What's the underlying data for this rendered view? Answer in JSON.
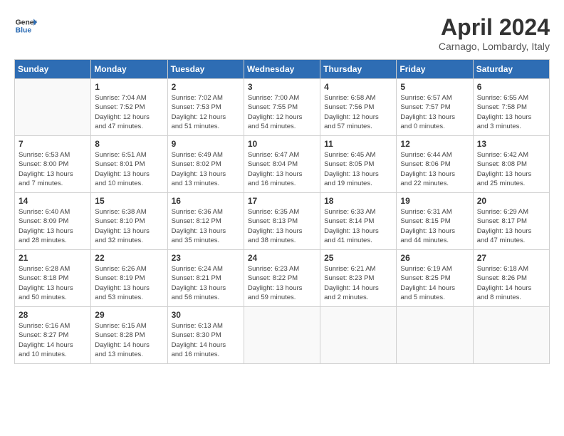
{
  "header": {
    "logo_line1": "General",
    "logo_line2": "Blue",
    "month_year": "April 2024",
    "location": "Carnago, Lombardy, Italy"
  },
  "days_of_week": [
    "Sunday",
    "Monday",
    "Tuesday",
    "Wednesday",
    "Thursday",
    "Friday",
    "Saturday"
  ],
  "weeks": [
    [
      {
        "day": "",
        "info": ""
      },
      {
        "day": "1",
        "info": "Sunrise: 7:04 AM\nSunset: 7:52 PM\nDaylight: 12 hours\nand 47 minutes."
      },
      {
        "day": "2",
        "info": "Sunrise: 7:02 AM\nSunset: 7:53 PM\nDaylight: 12 hours\nand 51 minutes."
      },
      {
        "day": "3",
        "info": "Sunrise: 7:00 AM\nSunset: 7:55 PM\nDaylight: 12 hours\nand 54 minutes."
      },
      {
        "day": "4",
        "info": "Sunrise: 6:58 AM\nSunset: 7:56 PM\nDaylight: 12 hours\nand 57 minutes."
      },
      {
        "day": "5",
        "info": "Sunrise: 6:57 AM\nSunset: 7:57 PM\nDaylight: 13 hours\nand 0 minutes."
      },
      {
        "day": "6",
        "info": "Sunrise: 6:55 AM\nSunset: 7:58 PM\nDaylight: 13 hours\nand 3 minutes."
      }
    ],
    [
      {
        "day": "7",
        "info": "Sunrise: 6:53 AM\nSunset: 8:00 PM\nDaylight: 13 hours\nand 7 minutes."
      },
      {
        "day": "8",
        "info": "Sunrise: 6:51 AM\nSunset: 8:01 PM\nDaylight: 13 hours\nand 10 minutes."
      },
      {
        "day": "9",
        "info": "Sunrise: 6:49 AM\nSunset: 8:02 PM\nDaylight: 13 hours\nand 13 minutes."
      },
      {
        "day": "10",
        "info": "Sunrise: 6:47 AM\nSunset: 8:04 PM\nDaylight: 13 hours\nand 16 minutes."
      },
      {
        "day": "11",
        "info": "Sunrise: 6:45 AM\nSunset: 8:05 PM\nDaylight: 13 hours\nand 19 minutes."
      },
      {
        "day": "12",
        "info": "Sunrise: 6:44 AM\nSunset: 8:06 PM\nDaylight: 13 hours\nand 22 minutes."
      },
      {
        "day": "13",
        "info": "Sunrise: 6:42 AM\nSunset: 8:08 PM\nDaylight: 13 hours\nand 25 minutes."
      }
    ],
    [
      {
        "day": "14",
        "info": "Sunrise: 6:40 AM\nSunset: 8:09 PM\nDaylight: 13 hours\nand 28 minutes."
      },
      {
        "day": "15",
        "info": "Sunrise: 6:38 AM\nSunset: 8:10 PM\nDaylight: 13 hours\nand 32 minutes."
      },
      {
        "day": "16",
        "info": "Sunrise: 6:36 AM\nSunset: 8:12 PM\nDaylight: 13 hours\nand 35 minutes."
      },
      {
        "day": "17",
        "info": "Sunrise: 6:35 AM\nSunset: 8:13 PM\nDaylight: 13 hours\nand 38 minutes."
      },
      {
        "day": "18",
        "info": "Sunrise: 6:33 AM\nSunset: 8:14 PM\nDaylight: 13 hours\nand 41 minutes."
      },
      {
        "day": "19",
        "info": "Sunrise: 6:31 AM\nSunset: 8:15 PM\nDaylight: 13 hours\nand 44 minutes."
      },
      {
        "day": "20",
        "info": "Sunrise: 6:29 AM\nSunset: 8:17 PM\nDaylight: 13 hours\nand 47 minutes."
      }
    ],
    [
      {
        "day": "21",
        "info": "Sunrise: 6:28 AM\nSunset: 8:18 PM\nDaylight: 13 hours\nand 50 minutes."
      },
      {
        "day": "22",
        "info": "Sunrise: 6:26 AM\nSunset: 8:19 PM\nDaylight: 13 hours\nand 53 minutes."
      },
      {
        "day": "23",
        "info": "Sunrise: 6:24 AM\nSunset: 8:21 PM\nDaylight: 13 hours\nand 56 minutes."
      },
      {
        "day": "24",
        "info": "Sunrise: 6:23 AM\nSunset: 8:22 PM\nDaylight: 13 hours\nand 59 minutes."
      },
      {
        "day": "25",
        "info": "Sunrise: 6:21 AM\nSunset: 8:23 PM\nDaylight: 14 hours\nand 2 minutes."
      },
      {
        "day": "26",
        "info": "Sunrise: 6:19 AM\nSunset: 8:25 PM\nDaylight: 14 hours\nand 5 minutes."
      },
      {
        "day": "27",
        "info": "Sunrise: 6:18 AM\nSunset: 8:26 PM\nDaylight: 14 hours\nand 8 minutes."
      }
    ],
    [
      {
        "day": "28",
        "info": "Sunrise: 6:16 AM\nSunset: 8:27 PM\nDaylight: 14 hours\nand 10 minutes."
      },
      {
        "day": "29",
        "info": "Sunrise: 6:15 AM\nSunset: 8:28 PM\nDaylight: 14 hours\nand 13 minutes."
      },
      {
        "day": "30",
        "info": "Sunrise: 6:13 AM\nSunset: 8:30 PM\nDaylight: 14 hours\nand 16 minutes."
      },
      {
        "day": "",
        "info": ""
      },
      {
        "day": "",
        "info": ""
      },
      {
        "day": "",
        "info": ""
      },
      {
        "day": "",
        "info": ""
      }
    ]
  ]
}
